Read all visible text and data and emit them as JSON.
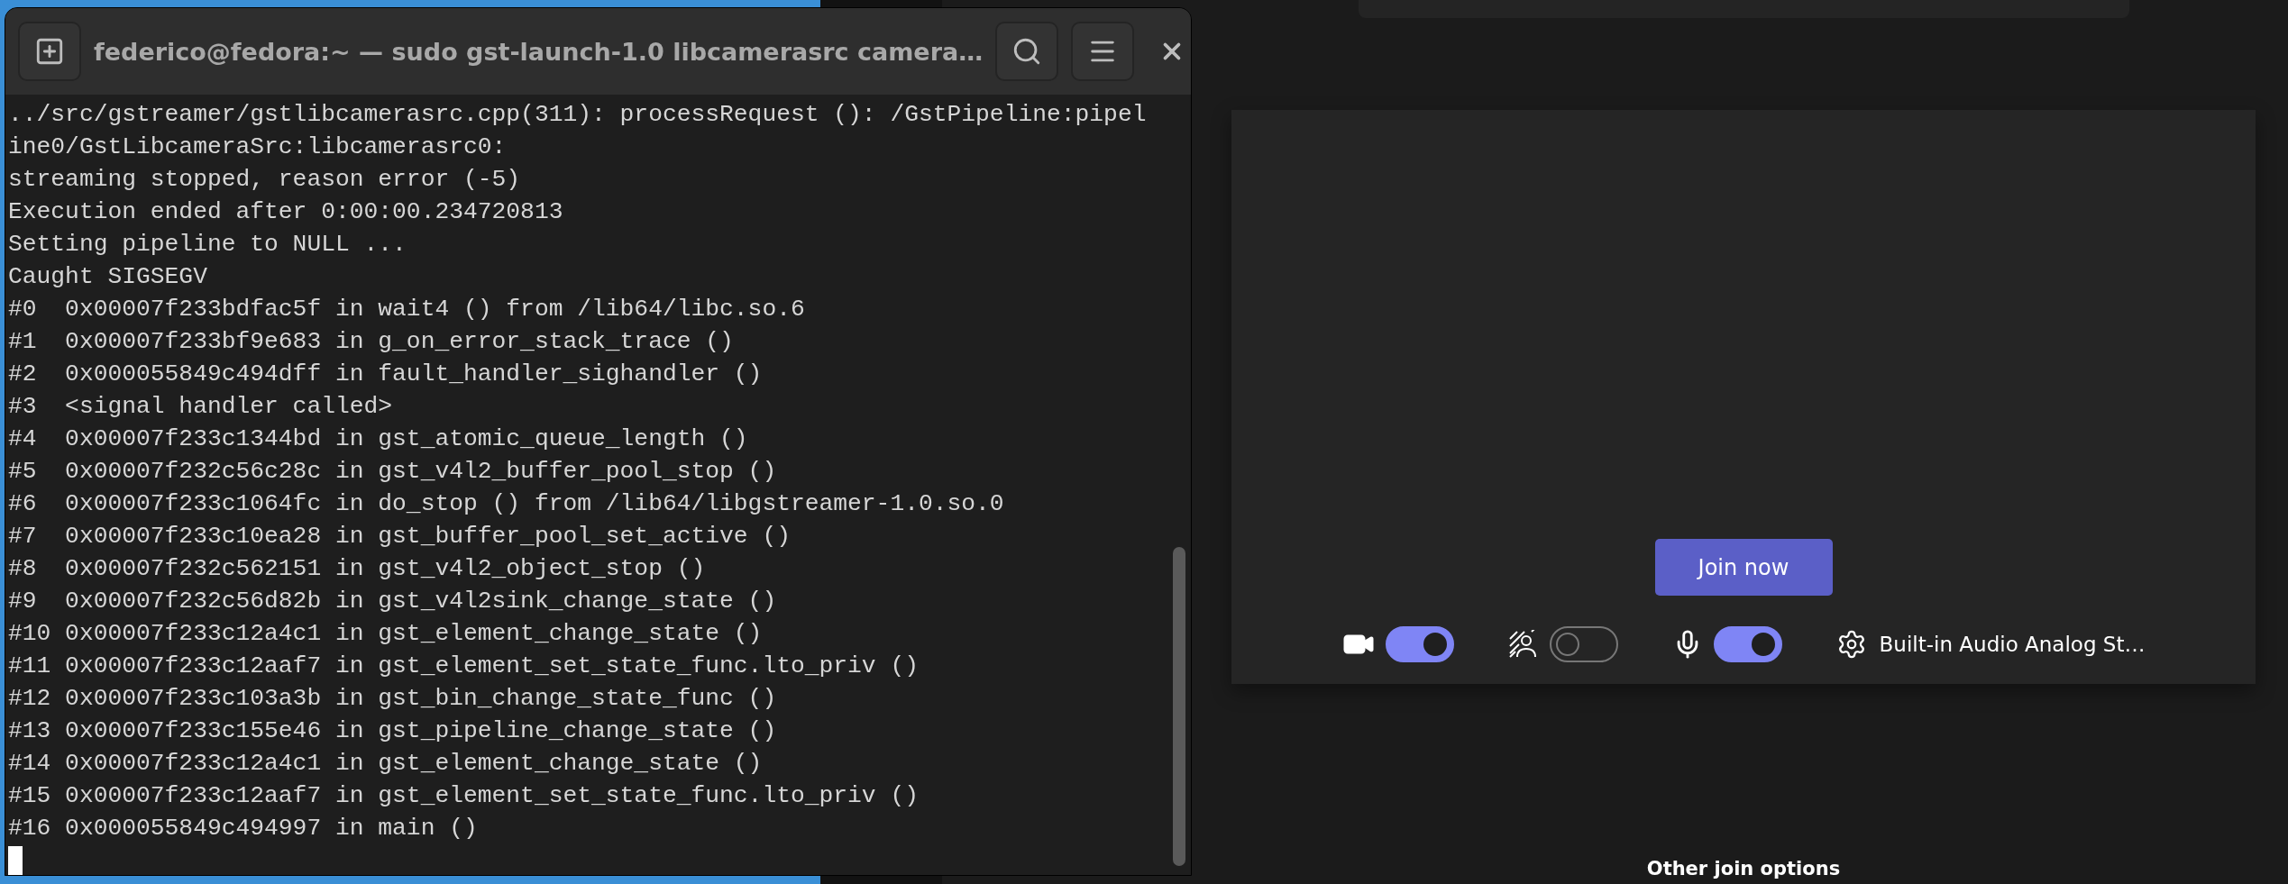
{
  "terminal": {
    "title": "federico@fedora:~ — sudo gst-launch-1.0 libcamerasrc camera…",
    "lines": [
      "../src/gstreamer/gstlibcamerasrc.cpp(311): processRequest (): /GstPipeline:pipel",
      "ine0/GstLibcameraSrc:libcamerasrc0:",
      "streaming stopped, reason error (-5)",
      "Execution ended after 0:00:00.234720813",
      "Setting pipeline to NULL ...",
      "Caught SIGSEGV",
      "#0  0x00007f233bdfac5f in wait4 () from /lib64/libc.so.6",
      "#1  0x00007f233bf9e683 in g_on_error_stack_trace ()",
      "#2  0x000055849c494dff in fault_handler_sighandler ()",
      "#3  <signal handler called>",
      "#4  0x00007f233c1344bd in gst_atomic_queue_length ()",
      "#5  0x00007f232c56c28c in gst_v4l2_buffer_pool_stop ()",
      "#6  0x00007f233c1064fc in do_stop () from /lib64/libgstreamer-1.0.so.0",
      "#7  0x00007f233c10ea28 in gst_buffer_pool_set_active ()",
      "#8  0x00007f232c562151 in gst_v4l2_object_stop ()",
      "#9  0x00007f232c56d82b in gst_v4l2sink_change_state ()",
      "#10 0x00007f233c12a4c1 in gst_element_change_state ()",
      "#11 0x00007f233c12aaf7 in gst_element_set_state_func.lto_priv ()",
      "#12 0x00007f233c103a3b in gst_bin_change_state_func ()",
      "#13 0x00007f233c155e46 in gst_pipeline_change_state ()",
      "#14 0x00007f233c12a4c1 in gst_element_change_state ()",
      "#15 0x00007f233c12aaf7 in gst_element_set_state_func.lto_priv ()",
      "#16 0x000055849c494997 in main ()"
    ]
  },
  "meeting": {
    "join_button": "Join now",
    "controls": [
      {
        "kind": "camera",
        "on": true
      },
      {
        "kind": "effects",
        "on": false
      },
      {
        "kind": "mic",
        "on": true
      }
    ],
    "audio_device": "Built-in Audio Analog St…",
    "other_options": "Other join options"
  }
}
